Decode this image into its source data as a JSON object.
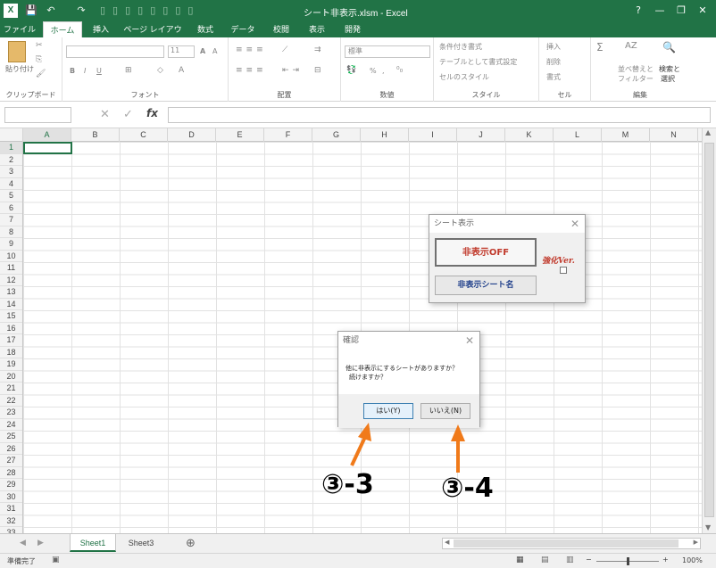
{
  "title": "シート非表示.xlsm - Excel",
  "qat": {
    "save": "💾",
    "undo": "↶",
    "redo": "↷"
  },
  "window": {
    "help": "?",
    "minimize": "—",
    "restore": "❐",
    "close": "✕"
  },
  "tabs": [
    "ファイル",
    "ホーム",
    "挿入",
    "ページ レイアウト",
    "数式",
    "データ",
    "校閲",
    "表示",
    "開発"
  ],
  "ribbon": {
    "clipboard": {
      "paste": "貼り付け",
      "label": "クリップボード"
    },
    "font": {
      "size": "11",
      "label": "フォント",
      "bold": "B",
      "italic": "I",
      "underline": "U",
      "grow": "A",
      "shrink": "A"
    },
    "alignment": {
      "label": "配置"
    },
    "number": {
      "format": "標準",
      "percent": "%",
      "comma": ",",
      "label": "数値"
    },
    "styles": {
      "conditional": "条件付き書式",
      "table": "テーブルとして書式設定",
      "cell": "セルのスタイル",
      "label": "スタイル"
    },
    "cells": {
      "insert": "挿入",
      "delete": "削除",
      "format": "書式",
      "label": "セル"
    },
    "editing": {
      "sort": "並べ替えと",
      "filter": "フィルター",
      "find": "検索と",
      "select": "選択",
      "label": "編集"
    }
  },
  "formula": {
    "fx": "fx",
    "cancel": "✕",
    "enter": "✓"
  },
  "columns": [
    "A",
    "B",
    "C",
    "D",
    "E",
    "F",
    "G",
    "H",
    "I",
    "J",
    "K",
    "L",
    "M",
    "N"
  ],
  "rows": [
    "1",
    "2",
    "3",
    "4",
    "5",
    "6",
    "7",
    "8",
    "9",
    "10",
    "11",
    "12",
    "13",
    "14",
    "15",
    "16",
    "17",
    "18",
    "19",
    "20",
    "21",
    "22",
    "23",
    "24",
    "25",
    "26",
    "27",
    "28",
    "29",
    "30",
    "31",
    "32",
    "33"
  ],
  "sheet_tabs": [
    "Sheet1",
    "Sheet3"
  ],
  "add_sheet": "⊕",
  "status": {
    "ready": "準備完了",
    "zoom": "100%",
    "minus": "−",
    "plus": "+"
  },
  "dialog_sheet": {
    "title": "シート表示",
    "off_button": "非表示OFF",
    "enhanced_label": "強化Ver.",
    "name_button": "非表示シート名"
  },
  "dialog_confirm": {
    "title": "確認",
    "message_line1": "他に非表示にするシートがありますか？",
    "message_line2": "続けますか？",
    "yes": "はい(Y)",
    "no": "いいえ(N)"
  },
  "callouts": {
    "a": "③-3",
    "b": "③-4"
  },
  "colors": {
    "excel_green": "#217346",
    "arrow": "#f07a1a",
    "off_text": "#c0392b",
    "name_text": "#1f3f8a"
  }
}
